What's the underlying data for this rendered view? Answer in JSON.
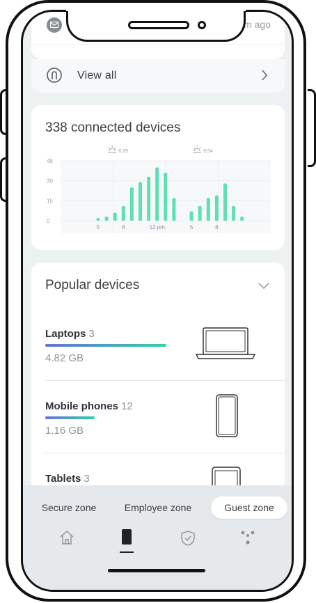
{
  "notifications": {
    "time_ago": "m ago",
    "view_all_label": "View all"
  },
  "devices_card": {
    "title": "338 connected devices"
  },
  "chart_data": {
    "type": "bar",
    "y_ticks": [
      "45",
      "30",
      "15",
      "0"
    ],
    "ylim": [
      0,
      45
    ],
    "x_tick_labels": [
      {
        "index": 0,
        "label": "5"
      },
      {
        "index": 3,
        "label": "8"
      },
      {
        "index": 7,
        "label": "12 pm"
      },
      {
        "index": 11,
        "label": "5"
      },
      {
        "index": 14,
        "label": "8"
      }
    ],
    "annotations": [
      {
        "icon": "sunrise-icon",
        "label": "6:29",
        "index": 2
      },
      {
        "icon": "sunset-icon",
        "label": "5:54",
        "index": 12
      }
    ],
    "values": [
      2,
      3,
      6,
      11,
      25,
      29,
      33,
      40,
      36,
      17,
      0,
      7,
      11,
      17,
      19,
      28,
      11,
      3
    ],
    "accent_color": "#5ee0b1",
    "grid": true
  },
  "popular": {
    "title": "Popular devices",
    "items": [
      {
        "name": "Laptops",
        "count": "3",
        "size": "4.82 GB",
        "bar_fraction": 1.0,
        "icon": "laptop-icon"
      },
      {
        "name": "Mobile phones",
        "count": "12",
        "size": "1.16 GB",
        "bar_fraction": 0.41,
        "icon": "phone-icon"
      },
      {
        "name": "Tablets",
        "count": "3",
        "size": "",
        "bar_fraction": 0,
        "icon": "tablet-icon"
      }
    ]
  },
  "zones": {
    "secure": "Secure zone",
    "employee": "Employee zone",
    "guest": "Guest zone",
    "active": "guest"
  },
  "nav": [
    "home-icon",
    "device-icon",
    "shield-icon",
    "network-icon"
  ]
}
